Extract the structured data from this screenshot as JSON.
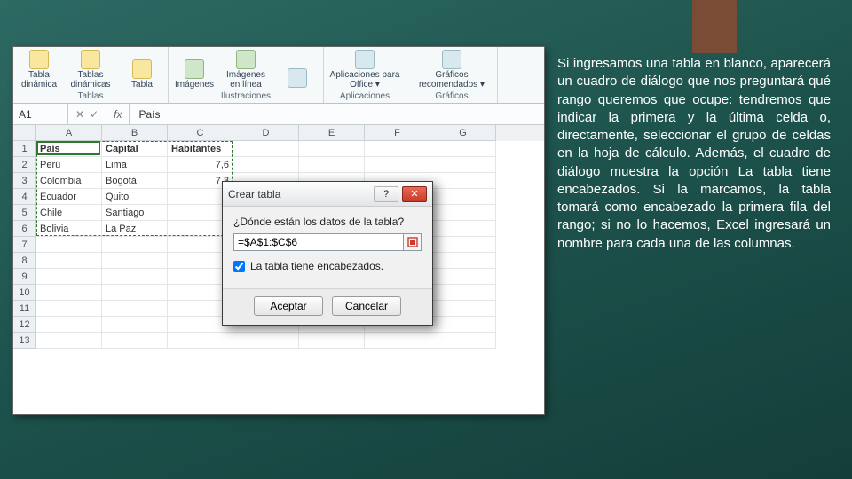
{
  "accent": {},
  "explain_text": "Si ingresamos una tabla en blanco, aparecerá un cuadro de diálogo que nos preguntará qué rango queremos que ocupe: tendremos que indicar la primera y la última celda o, directamente, seleccionar el grupo de celdas en la hoja de cálculo. Además, el cuadro de diálogo muestra la opción La tabla tiene encabezados. Si la marcamos, la tabla tomará como encabezado la primera fila del rango; si no lo hacemos, Excel ingresará un nombre para cada una de las columnas.",
  "ribbon": {
    "groups": [
      {
        "name": "Tablas",
        "items": [
          "Tabla dinámica",
          "Tablas dinámicas",
          "Tabla"
        ]
      },
      {
        "name": "Ilustraciones",
        "items": [
          "Imágenes",
          "Imágenes en línea",
          ""
        ]
      },
      {
        "name": "Aplicaciones",
        "items": [
          "Aplicaciones para Office ▾"
        ]
      },
      {
        "name": "Gráficos",
        "items": [
          "Gráficos recomendados ▾"
        ]
      }
    ]
  },
  "formula_bar": {
    "namebox": "A1",
    "cancel": "✕",
    "enter": "✓",
    "fx": "fx",
    "value": "País"
  },
  "columns": [
    "A",
    "B",
    "C",
    "D",
    "E",
    "F",
    "G"
  ],
  "rows_visible": 13,
  "data_rows": [
    [
      "País",
      "Capital",
      "Habitantes",
      "",
      "",
      "",
      ""
    ],
    [
      "Perú",
      "Lima",
      "7,6",
      "",
      "",
      "",
      ""
    ],
    [
      "Colombia",
      "Bogotá",
      "7,3",
      "",
      "",
      "",
      ""
    ],
    [
      "Ecuador",
      "Quito",
      "",
      "",
      "",
      "",
      ""
    ],
    [
      "Chile",
      "Santiago",
      "",
      "",
      "",
      "",
      ""
    ],
    [
      "Bolivia",
      "La Paz",
      "",
      "",
      "",
      "",
      ""
    ]
  ],
  "selection": {
    "r1": 1,
    "c1": 1,
    "r2": 6,
    "c2": 3
  },
  "dialog": {
    "title": "Crear tabla",
    "prompt": "¿Dónde están los datos de la tabla?",
    "range": "=$A$1:$C$6",
    "checkbox_label": "La tabla tiene encabezados.",
    "checked": true,
    "ok": "Aceptar",
    "cancel": "Cancelar",
    "help": "?",
    "close": "✕"
  }
}
